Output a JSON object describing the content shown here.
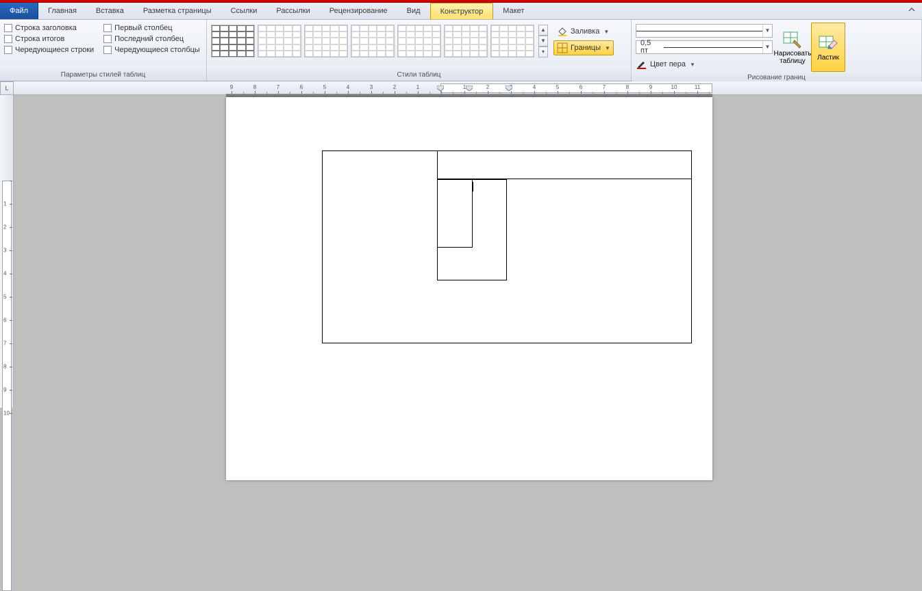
{
  "tabs": {
    "file": "Файл",
    "items": [
      "Главная",
      "Вставка",
      "Разметка страницы",
      "Ссылки",
      "Рассылки",
      "Рецензирование",
      "Вид"
    ],
    "context": [
      "Конструктор",
      "Макет"
    ],
    "active": "Конструктор"
  },
  "style_options": {
    "title": "Параметры стилей таблиц",
    "col1": [
      "Строка заголовка",
      "Строка итогов",
      "Чередующиеся строки"
    ],
    "col2": [
      "Первый столбец",
      "Последний столбец",
      "Чередующиеся столбцы"
    ]
  },
  "table_styles": {
    "title": "Стили таблиц"
  },
  "shading": {
    "label": "Заливка"
  },
  "borders": {
    "label": "Границы"
  },
  "draw_borders": {
    "title": "Рисование границ",
    "pen_width": "0,5 пт",
    "pen_color": "Цвет пера",
    "draw_table": "Нарисовать таблицу",
    "eraser": "Ластик"
  },
  "ruler": {
    "h_ticks": [
      "9",
      "8",
      "7",
      "6",
      "5",
      "4",
      "3",
      "2",
      "1",
      "",
      "1",
      "2",
      "3",
      "4",
      "5",
      "6",
      "7",
      "8",
      "9",
      "10",
      "11"
    ],
    "v_ticks": [
      "",
      "1",
      "2",
      "3",
      "4",
      "5",
      "6",
      "7",
      "8",
      "9",
      "10"
    ]
  }
}
